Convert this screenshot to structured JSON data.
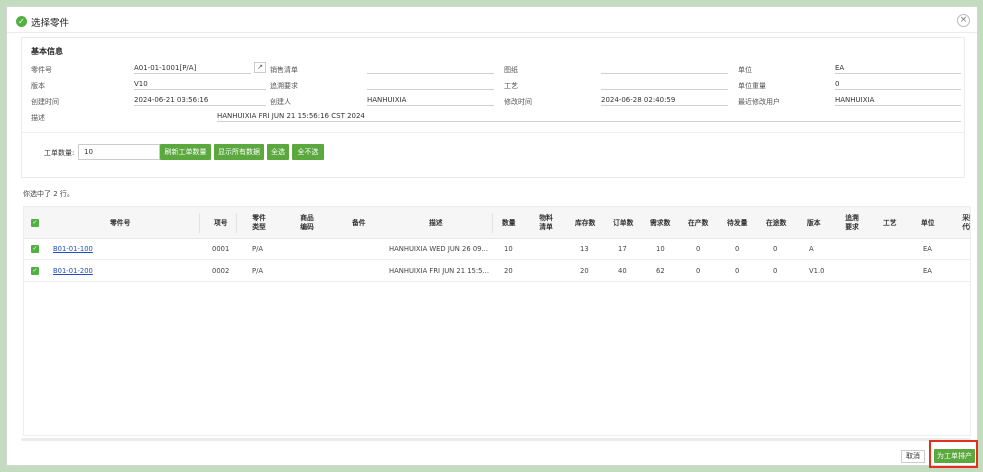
{
  "dialog": {
    "title": "选择零件",
    "close_label": "×",
    "title_icon": "check-icon"
  },
  "basic_info": {
    "section_title": "基本信息",
    "fields": {
      "part_no": {
        "label": "零件号",
        "value": "A01-01-1001[P/A]"
      },
      "sales_list": {
        "label": "销售清单",
        "value": ""
      },
      "drawing": {
        "label": "图纸",
        "value": ""
      },
      "unit": {
        "label": "单位",
        "value": "EA"
      },
      "version": {
        "label": "版本",
        "value": "V10"
      },
      "trace_req": {
        "label": "追溯要求",
        "value": ""
      },
      "process": {
        "label": "工艺",
        "value": ""
      },
      "unit_weight": {
        "label": "单位重量",
        "value": "0"
      },
      "created_time": {
        "label": "创建时间",
        "value": "2024-06-21 03:56:16"
      },
      "creator": {
        "label": "创建人",
        "value": "HANHUIXIA"
      },
      "modified_time": {
        "label": "修改时间",
        "value": "2024-06-28 02:40:59"
      },
      "last_modifier": {
        "label": "最近修改用户",
        "value": "HANHUIXIA"
      },
      "description": {
        "label": "描述",
        "value": "HANHUIXIA FRI JUN 21 15:56:16 CST 2024"
      }
    },
    "link_icon": "↗"
  },
  "work_order": {
    "count_label": "工单数量:",
    "count_value": "10",
    "buttons": {
      "refresh": "刷新工单数量",
      "show_all": "显示所有数据",
      "select_all": "全选",
      "select_none": "全不选"
    }
  },
  "selection_text": "你选中了 2 行。",
  "table": {
    "headers": {
      "part_no": "零件号",
      "item_no": "项号",
      "part_type": "零件类型",
      "product_code": "商品编码",
      "remark": "备件",
      "desc": "描述",
      "qty": "数量",
      "bom": "物料清单",
      "stock": "库存数",
      "order_qty": "订单数",
      "demand": "需求数",
      "in_production": "在产数",
      "pending": "待发量",
      "in_transit": "在途数",
      "version": "版本",
      "trace": "追溯要求",
      "process": "工艺",
      "unit": "单位",
      "purchase": "采购代码"
    },
    "rows": [
      {
        "part_no": "B01-01-100",
        "item_no": "0001",
        "part_type": "P/A",
        "desc": "HANHUIXIA WED JUN 26 09...",
        "qty": "10",
        "stock": "13",
        "order_qty": "17",
        "demand": "10",
        "in_production": "0",
        "pending": "0",
        "in_transit": "0",
        "version": "A",
        "unit": "EA"
      },
      {
        "part_no": "B01-01-200",
        "item_no": "0002",
        "part_type": "P/A",
        "desc": "HANHUIXIA FRI JUN 21 15:5...",
        "qty": "20",
        "stock": "20",
        "order_qty": "40",
        "demand": "62",
        "in_production": "0",
        "pending": "0",
        "in_transit": "0",
        "version": "V1.0",
        "unit": "EA"
      }
    ]
  },
  "footer": {
    "cancel": "取消",
    "primary": "为工单排产"
  },
  "colors": {
    "accent": "#5aa83e",
    "highlight": "#e0301e",
    "link": "#1f4fbf"
  }
}
